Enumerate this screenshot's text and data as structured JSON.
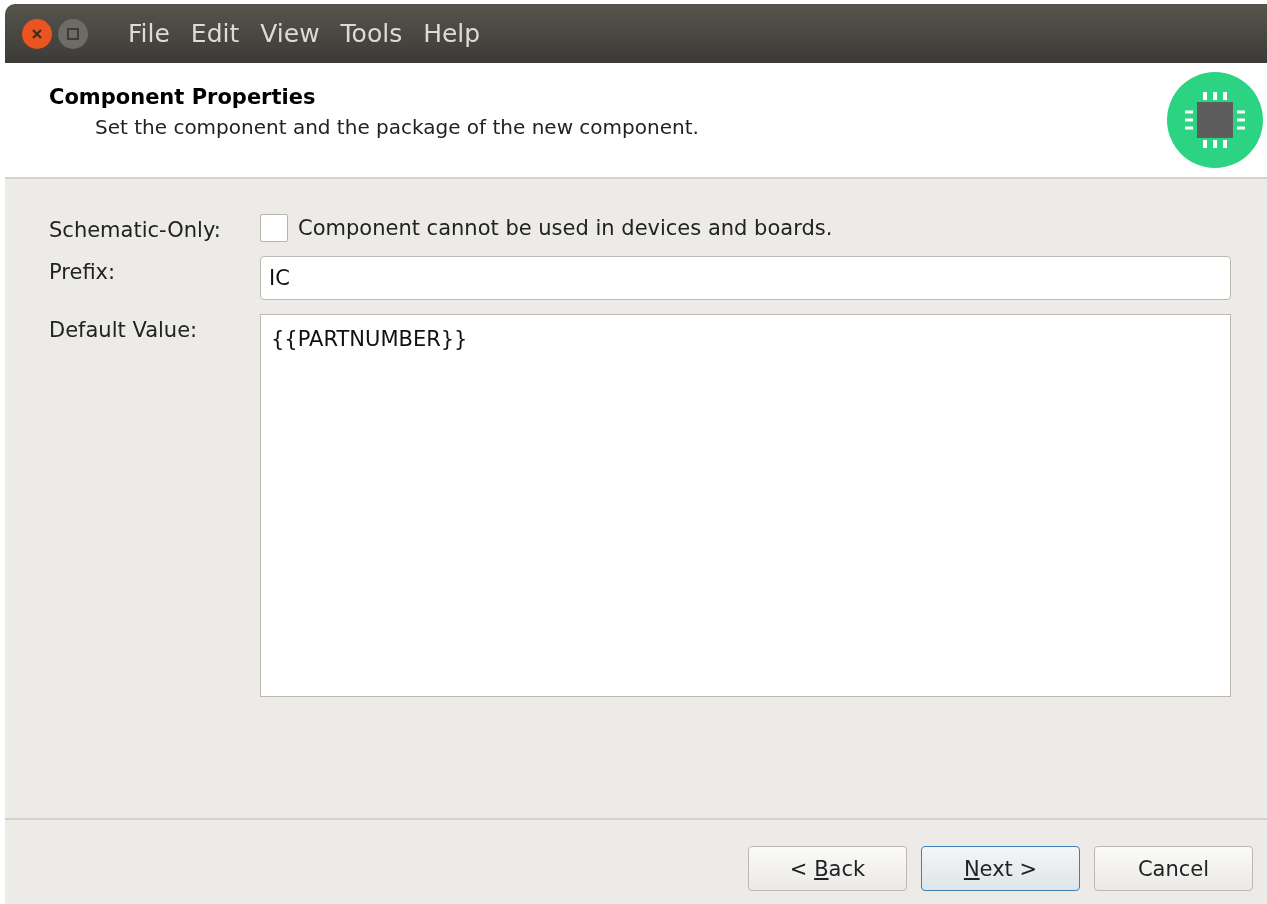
{
  "window": {
    "menu": [
      "File",
      "Edit",
      "View",
      "Tools",
      "Help"
    ]
  },
  "header": {
    "title": "Component Properties",
    "subtitle": "Set the component and the package of the new component."
  },
  "form": {
    "schematic_only": {
      "label": "Schematic-Only:",
      "checked": false,
      "text": "Component cannot be used in devices and boards."
    },
    "prefix": {
      "label": "Prefix:",
      "value": "IC"
    },
    "default_value": {
      "label": "Default Value:",
      "value": "{{PARTNUMBER}}"
    }
  },
  "buttons": [
    {
      "before": "< ",
      "key": "B",
      "after": "ack",
      "default": false
    },
    {
      "key": "N",
      "after": "ext >",
      "default": true
    },
    {
      "before": "Cancel",
      "default": false
    }
  ]
}
